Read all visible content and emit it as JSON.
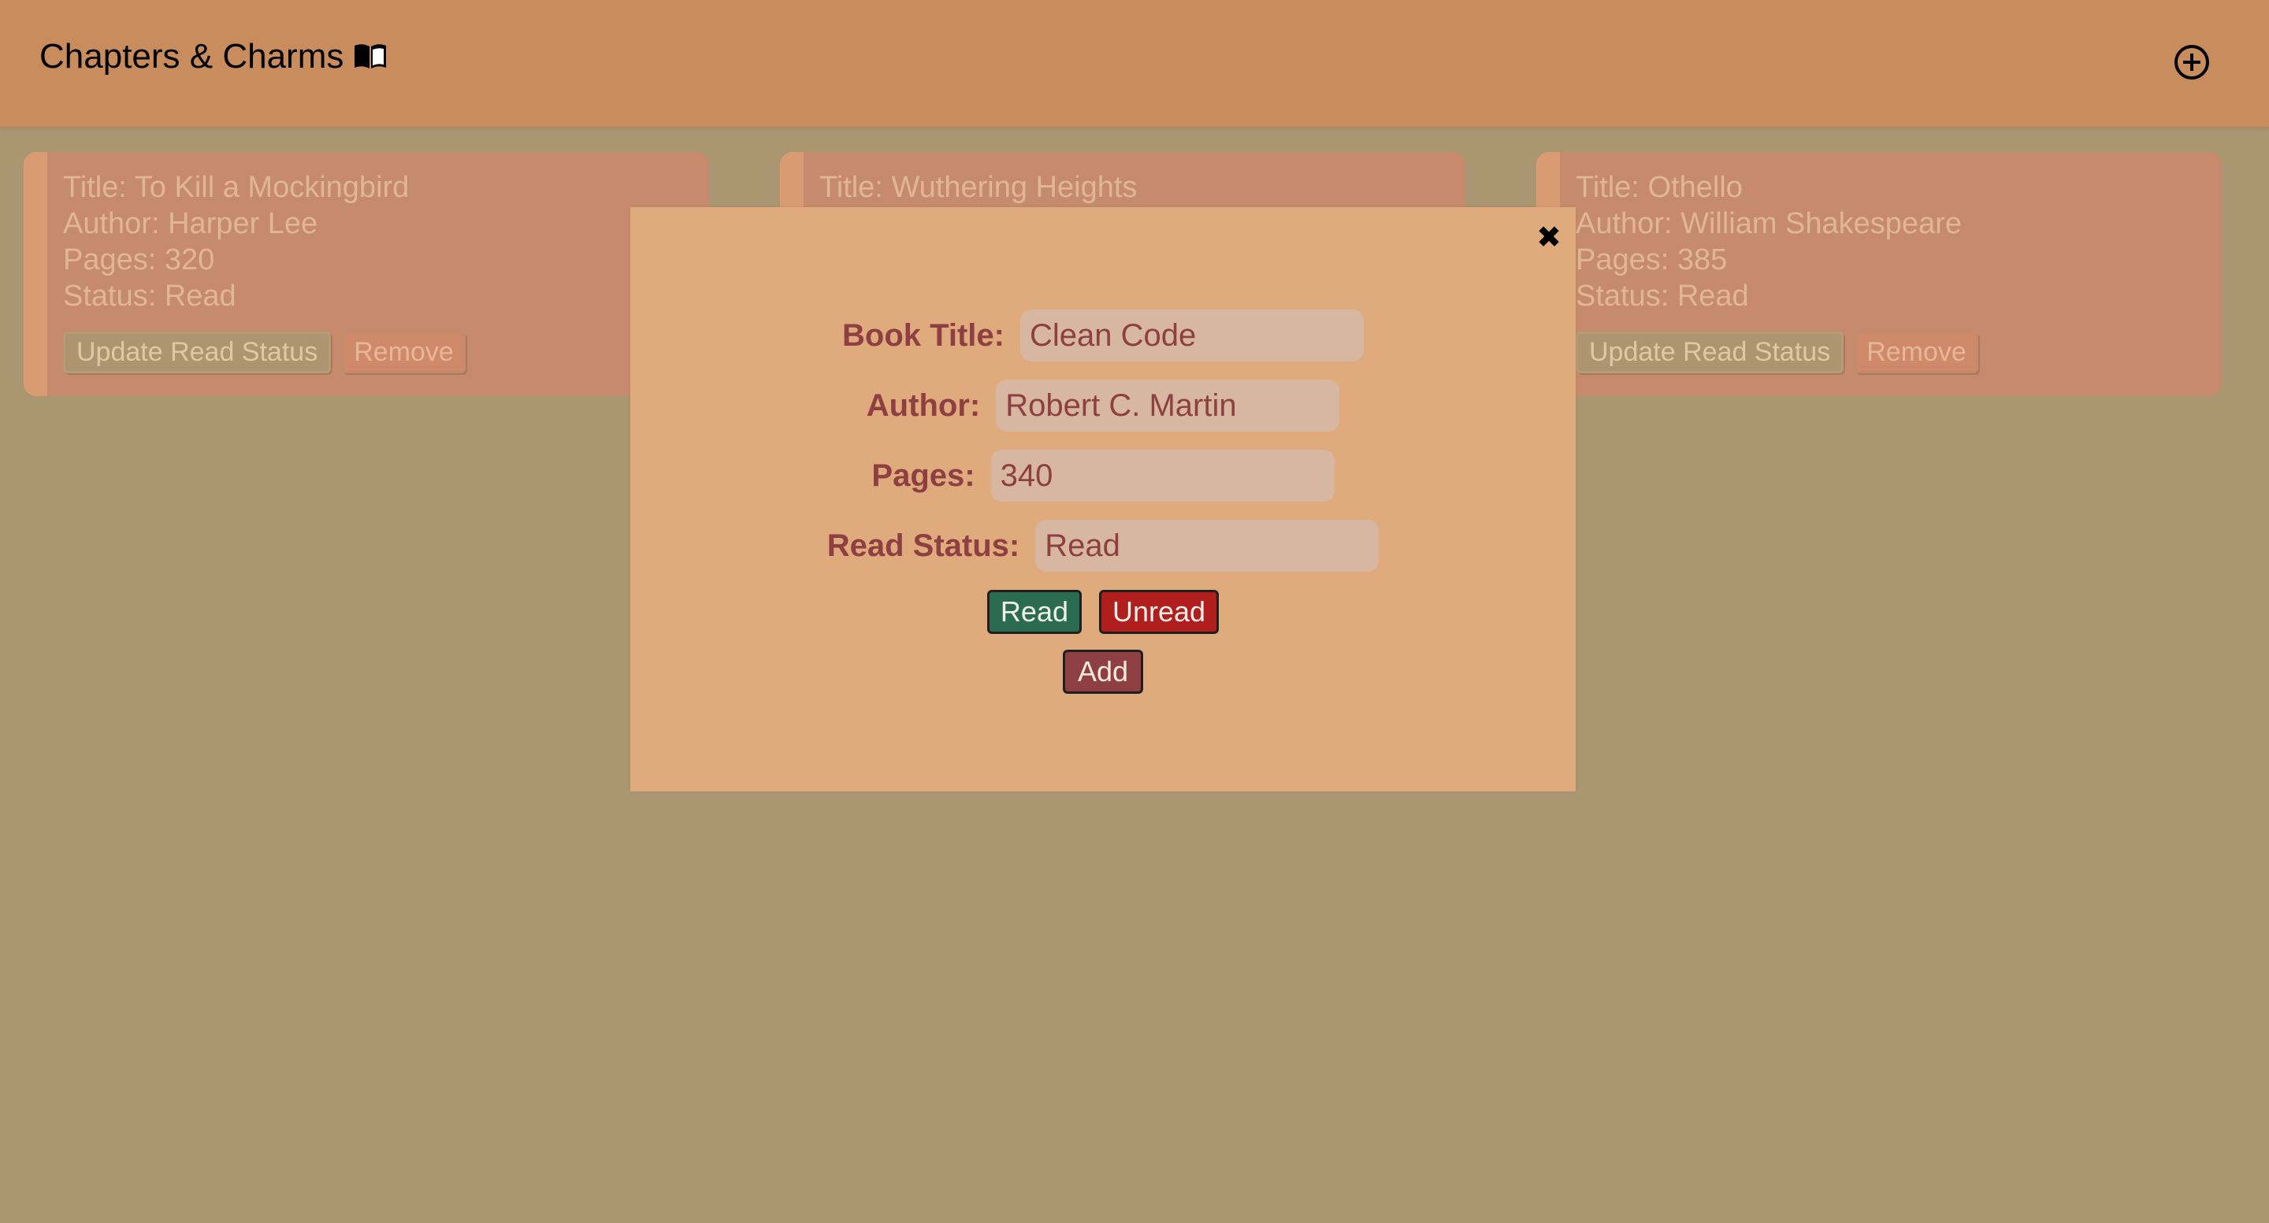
{
  "app": {
    "title": "Chapters & Charms",
    "logo_icon": "open-book-icon",
    "add_icon": "circle-plus-icon"
  },
  "books": [
    {
      "title": "Title: To Kill a Mockingbird",
      "author": "Author: Harper Lee",
      "pages": "Pages: 320",
      "status": "Status: Read",
      "update_label": "Update Read Status",
      "remove_label": "Remove"
    },
    {
      "title": "Title: Wuthering Heights"
    },
    {
      "title": "Title: Othello",
      "author": "Author: William Shakespeare",
      "pages": "Pages: 385",
      "status": "Status: Read",
      "update_label": "Update Read Status",
      "remove_label": "Remove"
    }
  ],
  "modal": {
    "close_icon": "close-x-icon",
    "fields": {
      "title": {
        "label": "Book Title:",
        "value": "Clean Code"
      },
      "author": {
        "label": "Author:",
        "value": "Robert C. Martin"
      },
      "pages": {
        "label": "Pages:",
        "value": "340"
      },
      "status": {
        "label": "Read Status:",
        "value": "Read"
      }
    },
    "read_label": "Read",
    "unread_label": "Unread",
    "add_label": "Add"
  },
  "colors": {
    "background": "#ab9672",
    "header": "#c98c5d",
    "modal": "#dfaa7c",
    "accent_text": "#8d3f42",
    "read_button": "#2a6b52",
    "unread_button": "#b01e1e"
  }
}
